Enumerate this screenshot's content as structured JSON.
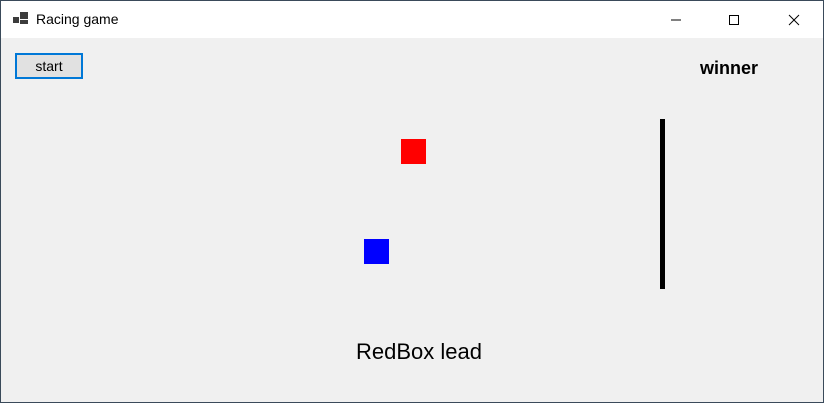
{
  "window": {
    "title": "Racing game",
    "app_icon": "windows-forms-app-icon",
    "controls": {
      "minimize_icon": "minimize-icon",
      "maximize_icon": "maximize-icon",
      "close_icon": "close-icon"
    }
  },
  "game": {
    "start_label": "start",
    "winner_label": "winner",
    "status_text": "RedBox lead",
    "red_box_color": "#ff0000",
    "blue_box_color": "#0000ff",
    "finish_line_color": "#000000"
  }
}
